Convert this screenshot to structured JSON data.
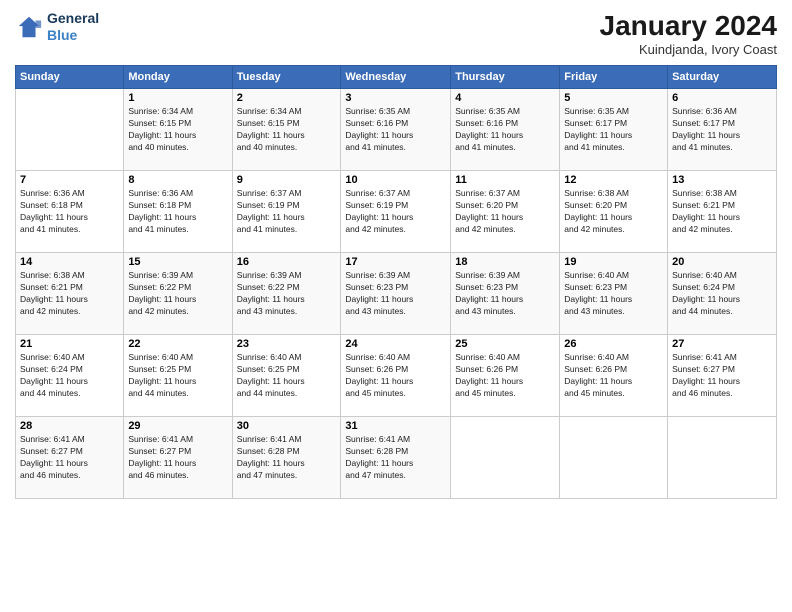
{
  "logo": {
    "line1": "General",
    "line2": "Blue"
  },
  "title": "January 2024",
  "subtitle": "Kuindjanda, Ivory Coast",
  "weekdays": [
    "Sunday",
    "Monday",
    "Tuesday",
    "Wednesday",
    "Thursday",
    "Friday",
    "Saturday"
  ],
  "weeks": [
    [
      {
        "day": "",
        "info": ""
      },
      {
        "day": "1",
        "info": "Sunrise: 6:34 AM\nSunset: 6:15 PM\nDaylight: 11 hours\nand 40 minutes."
      },
      {
        "day": "2",
        "info": "Sunrise: 6:34 AM\nSunset: 6:15 PM\nDaylight: 11 hours\nand 40 minutes."
      },
      {
        "day": "3",
        "info": "Sunrise: 6:35 AM\nSunset: 6:16 PM\nDaylight: 11 hours\nand 41 minutes."
      },
      {
        "day": "4",
        "info": "Sunrise: 6:35 AM\nSunset: 6:16 PM\nDaylight: 11 hours\nand 41 minutes."
      },
      {
        "day": "5",
        "info": "Sunrise: 6:35 AM\nSunset: 6:17 PM\nDaylight: 11 hours\nand 41 minutes."
      },
      {
        "day": "6",
        "info": "Sunrise: 6:36 AM\nSunset: 6:17 PM\nDaylight: 11 hours\nand 41 minutes."
      }
    ],
    [
      {
        "day": "7",
        "info": "Sunrise: 6:36 AM\nSunset: 6:18 PM\nDaylight: 11 hours\nand 41 minutes."
      },
      {
        "day": "8",
        "info": "Sunrise: 6:36 AM\nSunset: 6:18 PM\nDaylight: 11 hours\nand 41 minutes."
      },
      {
        "day": "9",
        "info": "Sunrise: 6:37 AM\nSunset: 6:19 PM\nDaylight: 11 hours\nand 41 minutes."
      },
      {
        "day": "10",
        "info": "Sunrise: 6:37 AM\nSunset: 6:19 PM\nDaylight: 11 hours\nand 42 minutes."
      },
      {
        "day": "11",
        "info": "Sunrise: 6:37 AM\nSunset: 6:20 PM\nDaylight: 11 hours\nand 42 minutes."
      },
      {
        "day": "12",
        "info": "Sunrise: 6:38 AM\nSunset: 6:20 PM\nDaylight: 11 hours\nand 42 minutes."
      },
      {
        "day": "13",
        "info": "Sunrise: 6:38 AM\nSunset: 6:21 PM\nDaylight: 11 hours\nand 42 minutes."
      }
    ],
    [
      {
        "day": "14",
        "info": "Sunrise: 6:38 AM\nSunset: 6:21 PM\nDaylight: 11 hours\nand 42 minutes."
      },
      {
        "day": "15",
        "info": "Sunrise: 6:39 AM\nSunset: 6:22 PM\nDaylight: 11 hours\nand 42 minutes."
      },
      {
        "day": "16",
        "info": "Sunrise: 6:39 AM\nSunset: 6:22 PM\nDaylight: 11 hours\nand 43 minutes."
      },
      {
        "day": "17",
        "info": "Sunrise: 6:39 AM\nSunset: 6:23 PM\nDaylight: 11 hours\nand 43 minutes."
      },
      {
        "day": "18",
        "info": "Sunrise: 6:39 AM\nSunset: 6:23 PM\nDaylight: 11 hours\nand 43 minutes."
      },
      {
        "day": "19",
        "info": "Sunrise: 6:40 AM\nSunset: 6:23 PM\nDaylight: 11 hours\nand 43 minutes."
      },
      {
        "day": "20",
        "info": "Sunrise: 6:40 AM\nSunset: 6:24 PM\nDaylight: 11 hours\nand 44 minutes."
      }
    ],
    [
      {
        "day": "21",
        "info": "Sunrise: 6:40 AM\nSunset: 6:24 PM\nDaylight: 11 hours\nand 44 minutes."
      },
      {
        "day": "22",
        "info": "Sunrise: 6:40 AM\nSunset: 6:25 PM\nDaylight: 11 hours\nand 44 minutes."
      },
      {
        "day": "23",
        "info": "Sunrise: 6:40 AM\nSunset: 6:25 PM\nDaylight: 11 hours\nand 44 minutes."
      },
      {
        "day": "24",
        "info": "Sunrise: 6:40 AM\nSunset: 6:26 PM\nDaylight: 11 hours\nand 45 minutes."
      },
      {
        "day": "25",
        "info": "Sunrise: 6:40 AM\nSunset: 6:26 PM\nDaylight: 11 hours\nand 45 minutes."
      },
      {
        "day": "26",
        "info": "Sunrise: 6:40 AM\nSunset: 6:26 PM\nDaylight: 11 hours\nand 45 minutes."
      },
      {
        "day": "27",
        "info": "Sunrise: 6:41 AM\nSunset: 6:27 PM\nDaylight: 11 hours\nand 46 minutes."
      }
    ],
    [
      {
        "day": "28",
        "info": "Sunrise: 6:41 AM\nSunset: 6:27 PM\nDaylight: 11 hours\nand 46 minutes."
      },
      {
        "day": "29",
        "info": "Sunrise: 6:41 AM\nSunset: 6:27 PM\nDaylight: 11 hours\nand 46 minutes."
      },
      {
        "day": "30",
        "info": "Sunrise: 6:41 AM\nSunset: 6:28 PM\nDaylight: 11 hours\nand 47 minutes."
      },
      {
        "day": "31",
        "info": "Sunrise: 6:41 AM\nSunset: 6:28 PM\nDaylight: 11 hours\nand 47 minutes."
      },
      {
        "day": "",
        "info": ""
      },
      {
        "day": "",
        "info": ""
      },
      {
        "day": "",
        "info": ""
      }
    ]
  ]
}
